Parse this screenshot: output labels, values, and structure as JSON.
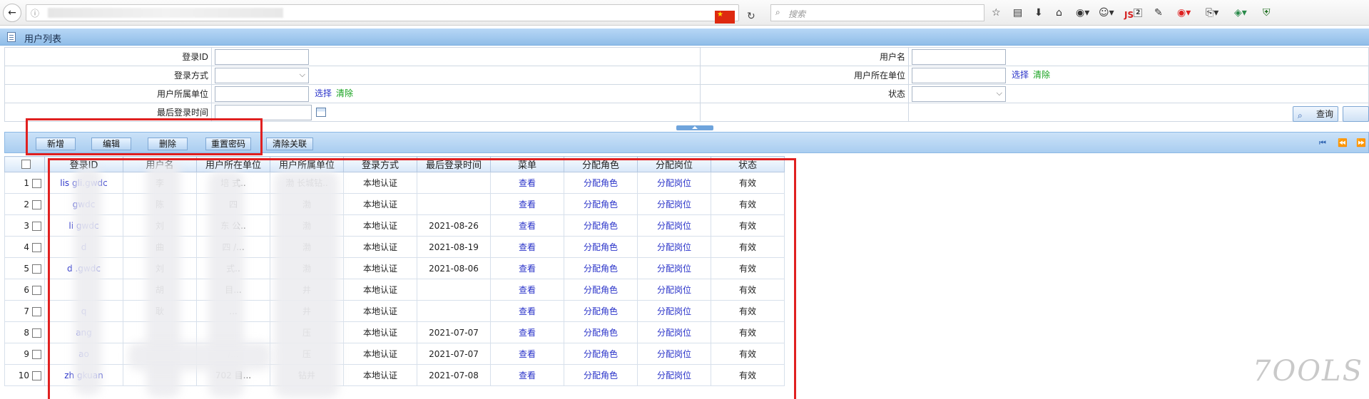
{
  "browser": {
    "search_placeholder": "搜索",
    "js_badge": "JS",
    "js_count": "2"
  },
  "page": {
    "title": "用户列表"
  },
  "filters": {
    "login_id_label": "登录ID",
    "login_method_label": "登录方式",
    "user_unit_label": "用户所属单位",
    "last_login_label": "最后登录时间",
    "username_label": "用户名",
    "user_location_unit_label": "用户所在单位",
    "status_label": "状态",
    "select_label": "选择",
    "clear_label": "清除",
    "query_label": "查询"
  },
  "toolbar": {
    "add": "新增",
    "edit": "编辑",
    "delete": "删除",
    "reset_password": "重置密码",
    "clear_link": "清除关联"
  },
  "grid": {
    "columns": [
      "登录ID",
      "用户名",
      "用户所在单位",
      "用户所属单位",
      "登录方式",
      "最后登录时间",
      "菜单",
      "分配角色",
      "分配岗位",
      "状态"
    ],
    "rows": [
      {
        "no": "1",
        "login": "lis    gli.gwdc",
        "name": "李",
        "loc": "培     式..",
        "unit": "渤    长城钻..",
        "method": "本地认证",
        "last": "",
        "menu": "查看",
        "role": "分配角色",
        "post": "分配岗位",
        "status": "有效"
      },
      {
        "no": "2",
        "login": "    gwdc",
        "name": "陈",
        "loc": "四",
        "unit": "渤",
        "method": "本地认证",
        "last": "",
        "menu": "查看",
        "role": "分配角色",
        "post": "分配岗位",
        "status": "有效"
      },
      {
        "no": "3",
        "login": "li    gwdc",
        "name": "刘",
        "loc": "东     公..",
        "unit": "渤",
        "method": "本地认证",
        "last": "2021-08-26",
        "menu": "查看",
        "role": "分配角色",
        "post": "分配岗位",
        "status": "有效"
      },
      {
        "no": "4",
        "login": "    d",
        "name": "曲",
        "loc": "四     /...",
        "unit": "渤",
        "method": "本地认证",
        "last": "2021-08-19",
        "menu": "查看",
        "role": "分配角色",
        "post": "分配岗位",
        "status": "有效"
      },
      {
        "no": "5",
        "login": "d    .gwdc",
        "name": "刘",
        "loc": "     式..",
        "unit": "渤",
        "method": "本地认证",
        "last": "2021-08-06",
        "menu": "查看",
        "role": "分配角色",
        "post": "分配岗位",
        "status": "有效"
      },
      {
        "no": "6",
        "login": "",
        "name": "胡",
        "loc": "     目...",
        "unit": "井",
        "method": "本地认证",
        "last": "",
        "menu": "查看",
        "role": "分配角色",
        "post": "分配岗位",
        "status": "有效"
      },
      {
        "no": "7",
        "login": "    q",
        "name": "耿",
        "loc": "     ...",
        "unit": "井",
        "method": "本地认证",
        "last": "",
        "menu": "查看",
        "role": "分配角色",
        "post": "分配岗位",
        "status": "有效"
      },
      {
        "no": "8",
        "login": "    ang",
        "name": "",
        "loc": "",
        "unit": "压",
        "method": "本地认证",
        "last": "2021-07-07",
        "menu": "查看",
        "role": "分配角色",
        "post": "分配岗位",
        "status": "有效"
      },
      {
        "no": "9",
        "login": "    ao",
        "name": "",
        "loc": "     /...",
        "unit": "压",
        "method": "本地认证",
        "last": "2021-07-07",
        "menu": "查看",
        "role": "分配角色",
        "post": "分配岗位",
        "status": "有效"
      },
      {
        "no": "10",
        "login": "zh    gkuan",
        "name": "",
        "loc": "702    目...",
        "unit": "钻井",
        "method": "本地认证",
        "last": "2021-07-08",
        "menu": "查看",
        "role": "分配角色",
        "post": "分配岗位",
        "status": "有效"
      }
    ]
  },
  "watermark": "7OOLS"
}
